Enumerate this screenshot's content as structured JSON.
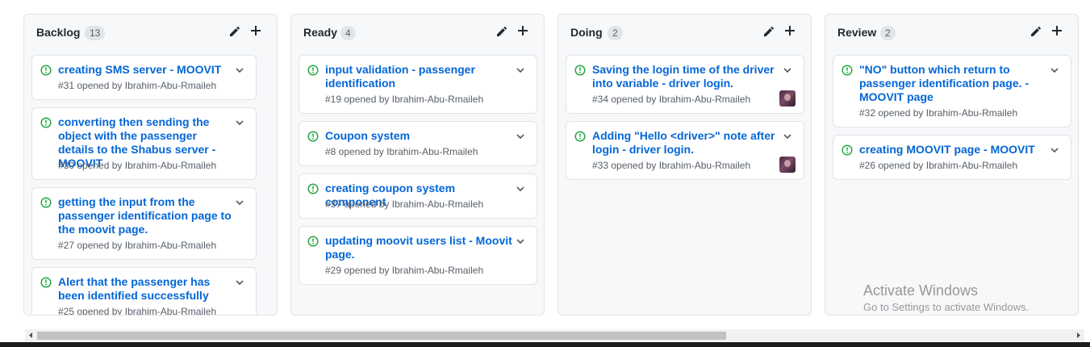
{
  "columns": [
    {
      "title": "Backlog",
      "count": "13",
      "cards": [
        {
          "title": "creating SMS server - MOOVIT",
          "meta": "#31 opened by Ibrahim-Abu-Rmaileh"
        },
        {
          "title": "converting then sending the object with the passenger details to the Shabus server -MOOVIT",
          "meta": "#30 opened by Ibrahim-Abu-Rmaileh"
        },
        {
          "title": "getting the input from the passenger identification page to the moovit page.",
          "meta": "#27 opened by Ibrahim-Abu-Rmaileh"
        },
        {
          "title": "Alert that the passenger has been identified successfully",
          "meta": "#25 opened by Ibrahim-Abu-Rmaileh"
        }
      ]
    },
    {
      "title": "Ready",
      "count": "4",
      "cards": [
        {
          "title": "input validation - passenger identification",
          "meta": "#19 opened by Ibrahim-Abu-Rmaileh"
        },
        {
          "title": "Coupon system",
          "meta": "#8 opened by Ibrahim-Abu-Rmaileh"
        },
        {
          "title": "creating coupon system component",
          "meta": "#37 opened by Ibrahim-Abu-Rmaileh"
        },
        {
          "title": "updating moovit users list - Moovit page.",
          "meta": "#29 opened by Ibrahim-Abu-Rmaileh"
        }
      ]
    },
    {
      "title": "Doing",
      "count": "2",
      "cards": [
        {
          "title": "Saving the login time of the driver into variable - driver login.",
          "meta": "#34 opened by Ibrahim-Abu-Rmaileh"
        },
        {
          "title": "Adding \"Hello <driver>\" note after login - driver login.",
          "meta": "#33 opened by Ibrahim-Abu-Rmaileh"
        }
      ]
    },
    {
      "title": "Review",
      "count": "2",
      "cards": [
        {
          "title": "\"NO\" button which return to passenger identification page. - MOOVIT page",
          "meta": "#32 opened by Ibrahim-Abu-Rmaileh"
        },
        {
          "title": "creating MOOVIT page - MOOVIT",
          "meta": "#26 opened by Ibrahim-Abu-Rmaileh"
        }
      ]
    }
  ],
  "watermark": {
    "title": "Activate Windows",
    "subtitle": "Go to Settings to activate Windows."
  },
  "icons": {
    "issue_open": "issue-open-icon",
    "edit": "pencil-icon",
    "add": "plus-icon",
    "expand": "chevron-down-icon"
  },
  "colors": {
    "issue_open": "#28a745",
    "link": "#0366d6",
    "meta": "#586069",
    "column_bg": "#f6f8fa",
    "border": "#e1e4e8"
  }
}
